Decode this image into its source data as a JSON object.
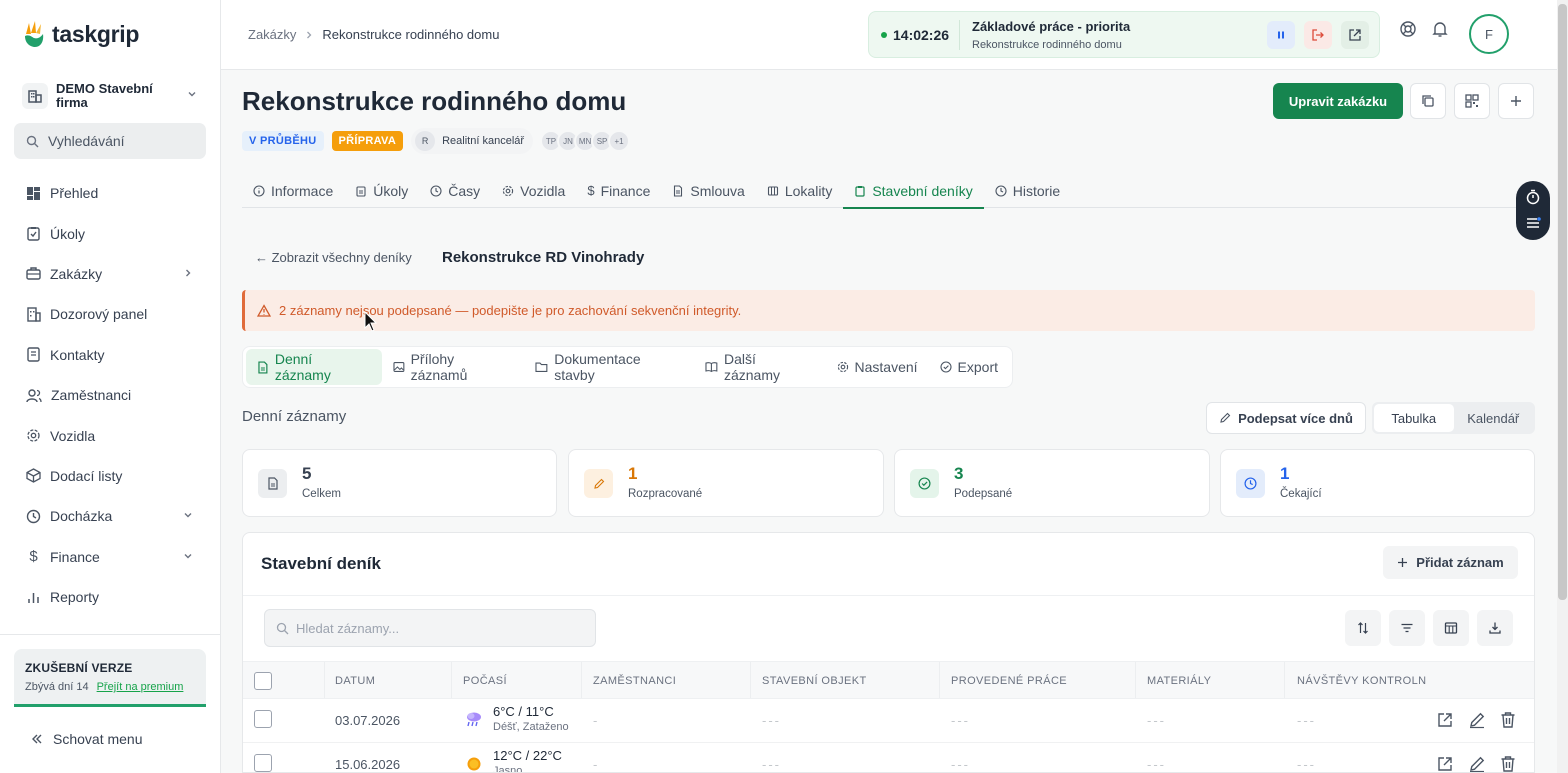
{
  "sidebar": {
    "logo_text": "taskgrip",
    "company": "DEMO Stavební firma",
    "search_label": "Vyhledávání",
    "items": [
      {
        "label": "Přehled",
        "icon": "dashboard-icon"
      },
      {
        "label": "Úkoly",
        "icon": "clipboard-check-icon"
      },
      {
        "label": "Zakázky",
        "icon": "briefcase-icon",
        "chevron": "right"
      },
      {
        "label": "Dozorový panel",
        "icon": "building-icon"
      },
      {
        "label": "Kontakty",
        "icon": "contact-book-icon"
      },
      {
        "label": "Zaměstnanci",
        "icon": "users-icon"
      },
      {
        "label": "Vozidla",
        "icon": "gear-icon"
      },
      {
        "label": "Dodací listy",
        "icon": "package-icon"
      },
      {
        "label": "Docházka",
        "icon": "clock-icon",
        "chevron": "down"
      },
      {
        "label": "Finance",
        "icon": "dollar-icon",
        "chevron": "down"
      },
      {
        "label": "Reporty",
        "icon": "bar-chart-icon"
      }
    ],
    "trial": {
      "title": "ZKUŠEBNÍ VERZE",
      "days_left": "Zbývá dní 14",
      "premium_link": "Přejít na premium"
    },
    "hide_menu": "Schovat menu"
  },
  "topbar": {
    "breadcrumb": [
      "Zakázky",
      "Rekonstrukce rodinného domu"
    ],
    "timer": {
      "time": "14:02:26",
      "title": "Základové práce - priorita",
      "subtitle": "Rekonstrukce rodinného domu"
    },
    "avatar_initial": "F"
  },
  "job": {
    "title": "Rekonstrukce rodinného domu",
    "status_badges": [
      "V PRŮBĚHU",
      "PŘÍPRAVA"
    ],
    "client_initial": "R",
    "client_name": "Realitní kancelář",
    "people": [
      "TP",
      "JN",
      "MN",
      "SP",
      "+1"
    ],
    "edit_button": "Upravit zakázku"
  },
  "tabs": [
    {
      "label": "Informace",
      "icon": "info-icon"
    },
    {
      "label": "Úkoly",
      "icon": "clipboard-icon"
    },
    {
      "label": "Časy",
      "icon": "clock-icon"
    },
    {
      "label": "Vozidla",
      "icon": "gear-icon"
    },
    {
      "label": "Finance",
      "icon": "dollar-icon"
    },
    {
      "label": "Smlouva",
      "icon": "document-icon"
    },
    {
      "label": "Lokality",
      "icon": "map-icon"
    },
    {
      "label": "Stavební deníky",
      "icon": "clipboard-icon",
      "active": true
    },
    {
      "label": "Historie",
      "icon": "history-icon"
    }
  ],
  "diary": {
    "back_link": "← Zobrazit všechny deníky",
    "title": "Rekonstrukce RD Vinohrady",
    "alert": "2 záznamy nejsou podepsané — podepište je pro zachování sekvenční integrity."
  },
  "subtabs": [
    {
      "label": "Denní záznamy",
      "icon": "document-icon",
      "active": true
    },
    {
      "label": "Přílohy záznamů",
      "icon": "image-icon"
    },
    {
      "label": "Dokumentace stavby",
      "icon": "folder-icon"
    },
    {
      "label": "Další záznamy",
      "icon": "book-icon"
    },
    {
      "label": "Nastavení",
      "icon": "gear-icon"
    },
    {
      "label": "Export",
      "icon": "check-circle-icon"
    }
  ],
  "records": {
    "section_label": "Denní záznamy",
    "sign_button": "Podepsat více dnů",
    "view_options": [
      "Tabulka",
      "Kalendář"
    ],
    "stats": [
      {
        "value": "5",
        "label": "Celkem",
        "color": "#1f2937",
        "icon": "document-icon"
      },
      {
        "value": "1",
        "label": "Rozpracované",
        "color": "#d97706",
        "icon": "pencil-icon"
      },
      {
        "value": "3",
        "label": "Podepsané",
        "color": "#16854f",
        "icon": "check-circle-icon"
      },
      {
        "value": "1",
        "label": "Čekající",
        "color": "#2563eb",
        "icon": "clock-icon"
      }
    ]
  },
  "table": {
    "title": "Stavební deník",
    "add_button": "Přidat záznam",
    "search_placeholder": "Hledat záznamy...",
    "columns": [
      "DATUM",
      "POČASÍ",
      "ZAMĚSTNANCI",
      "STAVEBNÍ OBJEKT",
      "PROVEDENÉ PRÁCE",
      "MATERIÁLY",
      "NÁVŠTĚVY KONTROLN"
    ],
    "rows": [
      {
        "date": "03.07.2026",
        "weather_temp": "6°C / 11°C",
        "weather_desc": "Déšť, Zataženo",
        "weather_icon": "rain-icon",
        "employees": "-",
        "object": "---",
        "works": "---",
        "materials": "---",
        "visits": "---"
      },
      {
        "date": "15.06.2026",
        "weather_temp": "12°C / 22°C",
        "weather_desc": "Jasno",
        "weather_icon": "sun-icon",
        "employees": "-",
        "object": "---",
        "works": "---",
        "materials": "---",
        "visits": "---"
      }
    ]
  }
}
